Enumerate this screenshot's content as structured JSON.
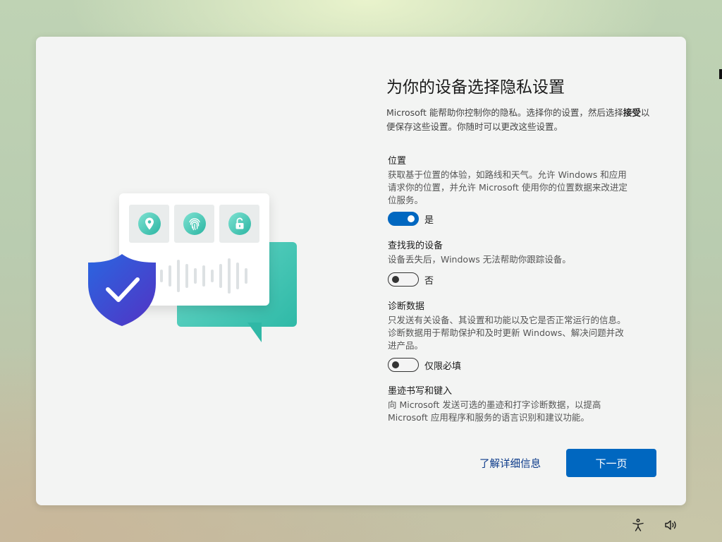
{
  "dialog": {
    "title": "为你的设备选择隐私设置",
    "intro_part1": "Microsoft 能帮助你控制你的隐私。选择你的设置，然后选择",
    "intro_bold": "接受",
    "intro_part2": "以便保存这些设置。你随时可以更改这些设置。"
  },
  "settings": [
    {
      "title": "位置",
      "description": "获取基于位置的体验，如路线和天气。允许 Windows 和应用请求你的位置，并允许 Microsoft 使用你的位置数据来改进定位服务。",
      "toggle_state": "on",
      "toggle_label": "是"
    },
    {
      "title": "查找我的设备",
      "description": "设备丢失后，Windows 无法帮助你跟踪设备。",
      "toggle_state": "off",
      "toggle_label": "否"
    },
    {
      "title": "诊断数据",
      "description": "只发送有关设备、其设置和功能以及它是否正常运行的信息。诊断数据用于帮助保护和及时更新 Windows、解决问题并改进产品。",
      "toggle_state": "off",
      "toggle_label": "仅限必填"
    },
    {
      "title": "墨迹书写和键入",
      "description": "向 Microsoft 发送可选的墨迹和打字诊断数据，以提高 Microsoft 应用程序和服务的语言识别和建议功能。"
    }
  ],
  "actions": {
    "learn_more": "了解详细信息",
    "next": "下一页"
  },
  "illustration": {
    "tiles": [
      "location-pin-icon",
      "fingerprint-icon",
      "unlocked-padlock-icon"
    ],
    "shield": "shield-check-icon",
    "bubble": "chat-bubble-icon"
  },
  "tray": [
    "accessibility-icon",
    "volume-icon"
  ],
  "colors": {
    "accent": "#0067c0",
    "teal": "#2fb9a7",
    "shield": "#3b4fd8",
    "link": "#0b3a8a"
  }
}
